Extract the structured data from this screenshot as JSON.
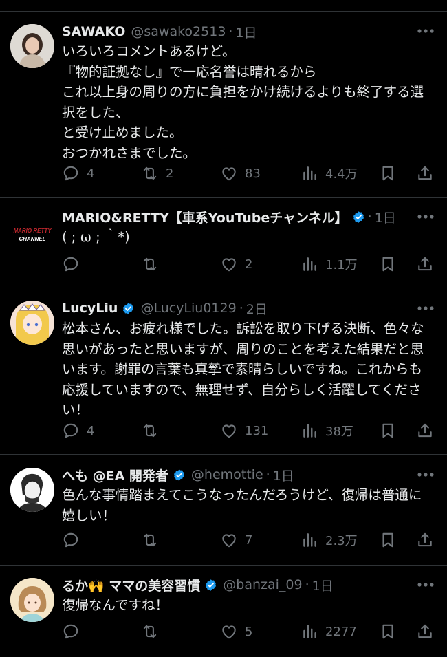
{
  "tweets": [
    {
      "name": "SAWAKO",
      "handle": "@sawako2513",
      "time": "1日",
      "verified": false,
      "lines": [
        "いろいろコメントあるけど。",
        "『物的証拠なし』で一応名誉は晴れるから",
        "これ以上身の周りの方に負担をかけ続けるよりも終了する選",
        "択をした、",
        "と受け止めました。",
        "おつかれさまでした。"
      ],
      "replies": "4",
      "retweets": "2",
      "likes": "83",
      "views": "4.4万"
    },
    {
      "name": "MARIO&RETTY【車系YouTubeチャンネル】",
      "handle": "",
      "time": "1日",
      "verified": true,
      "avatar_text_1": "MARIO RETTY",
      "avatar_text_2": "CHANNEL",
      "lines": [
        "( ; ω ; ｀*)"
      ],
      "replies": "",
      "retweets": "",
      "likes": "2",
      "views": "1.1万"
    },
    {
      "name": "LucyLiu",
      "handle": "@LucyLiu0129",
      "time": "2日",
      "verified": true,
      "lines": [
        "松本さん、お疲れ様でした。訴訟を取り下げる決断、色々な",
        "思いがあったと思いますが、周りのことを考えた結果だと思",
        "います。謝罪の言葉も真摯で素晴らしいですね。これからも",
        "応援していますので、無理せず、自分らしく活躍してくださ",
        "い！"
      ],
      "replies": "4",
      "retweets": "",
      "likes": "131",
      "views": "38万"
    },
    {
      "name": "へも @EA 開発者",
      "handle": "@hemottie",
      "time": "1日",
      "verified": true,
      "lines": [
        "色んな事情踏まえてこうなったんだろうけど、復帰は普通に",
        "嬉しい！"
      ],
      "replies": "",
      "retweets": "",
      "likes": "7",
      "views": "2.3万"
    },
    {
      "name": "るか🙌 ママの美容習慣",
      "handle": "@banzai_09",
      "time": "1日",
      "verified": true,
      "lines": [
        "復帰なんですね！"
      ],
      "replies": "",
      "retweets": "",
      "likes": "5",
      "views": "2277"
    }
  ],
  "colors": {
    "background": "#000000",
    "text": "#e7e9ea",
    "muted": "#71767b",
    "verified": "#1d9bf0",
    "divider": "#2f3336"
  },
  "icons": {
    "reply": "speech-bubble",
    "retweet": "retweet-arrows",
    "like": "heart",
    "views": "bar-chart",
    "bookmark": "bookmark",
    "share": "upload-arrow",
    "more": "three-dots"
  }
}
